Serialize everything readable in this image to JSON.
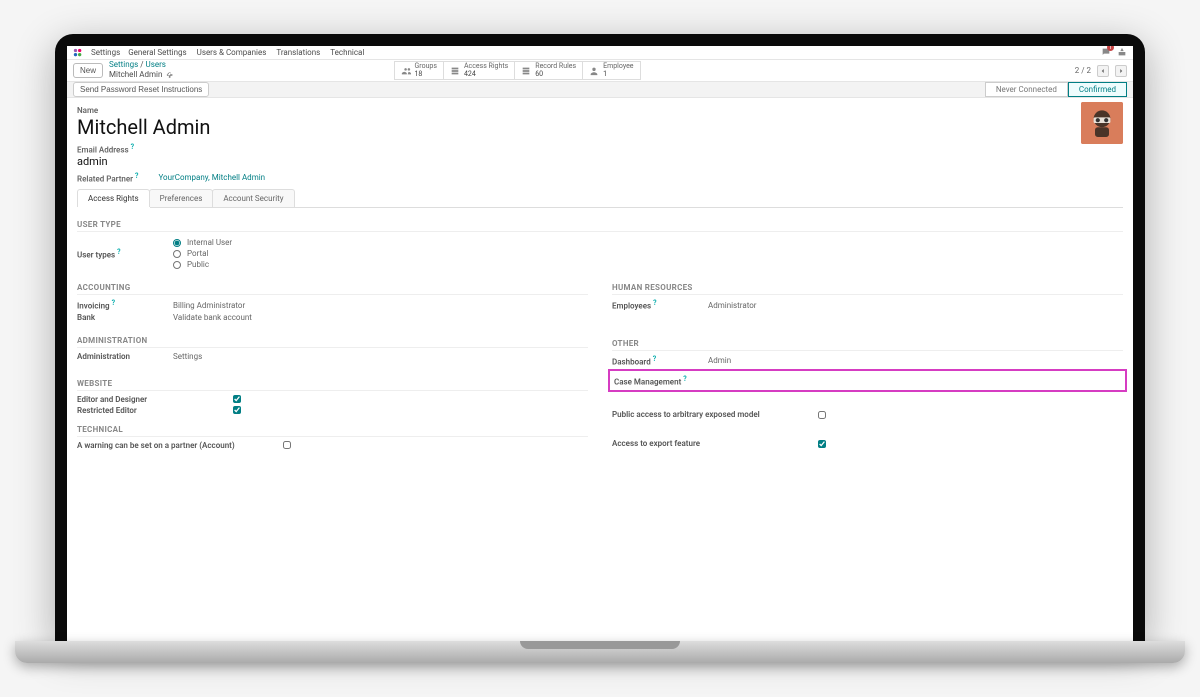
{
  "topbar": {
    "app": "Settings",
    "menus": [
      "General Settings",
      "Users & Companies",
      "Translations",
      "Technical"
    ],
    "msg_badge": "1"
  },
  "subbar": {
    "new_label": "New",
    "crumb_settings": "Settings",
    "crumb_sep": "/",
    "crumb_users": "Users",
    "crumb_record": "Mitchell Admin",
    "stats": [
      {
        "label": "Groups",
        "value": "18"
      },
      {
        "label": "Access Rights",
        "value": "424"
      },
      {
        "label": "Record Rules",
        "value": "60"
      },
      {
        "label": "Employee",
        "value": "1"
      }
    ],
    "pager_text": "2 / 2"
  },
  "statusbar": {
    "send_btn": "Send Password Reset Instructions",
    "stage_never": "Never Connected",
    "stage_confirmed": "Confirmed"
  },
  "form": {
    "name_label": "Name",
    "name_value": "Mitchell Admin",
    "email_label": "Email Address",
    "email_value": "admin",
    "partner_label": "Related Partner",
    "partner_link": "YourCompany, Mitchell Admin",
    "tabs": [
      "Access Rights",
      "Preferences",
      "Account Security"
    ],
    "usertype": {
      "section": "USER TYPE",
      "label": "User types",
      "opts": [
        "Internal User",
        "Portal",
        "Public"
      ]
    },
    "accounting": {
      "section": "ACCOUNTING",
      "invoicing_label": "Invoicing",
      "invoicing_value": "Billing Administrator",
      "bank_label": "Bank",
      "bank_value": "Validate bank account"
    },
    "hr": {
      "section": "HUMAN RESOURCES",
      "employees_label": "Employees",
      "employees_value": "Administrator"
    },
    "admin": {
      "section": "ADMINISTRATION",
      "admin_label": "Administration",
      "admin_value": "Settings"
    },
    "other": {
      "section": "OTHER",
      "dashboard_label": "Dashboard",
      "dashboard_value": "Admin",
      "case_label": "Case Management"
    },
    "website": {
      "section": "WEBSITE",
      "editor_label": "Editor and Designer",
      "restricted_label": "Restricted Editor",
      "publicaccess_label": "Public access to arbitrary exposed model"
    },
    "technical": {
      "section": "TECHNICAL",
      "warning_label": "A warning can be set on a partner (Account)",
      "export_label": "Access to export feature"
    }
  }
}
